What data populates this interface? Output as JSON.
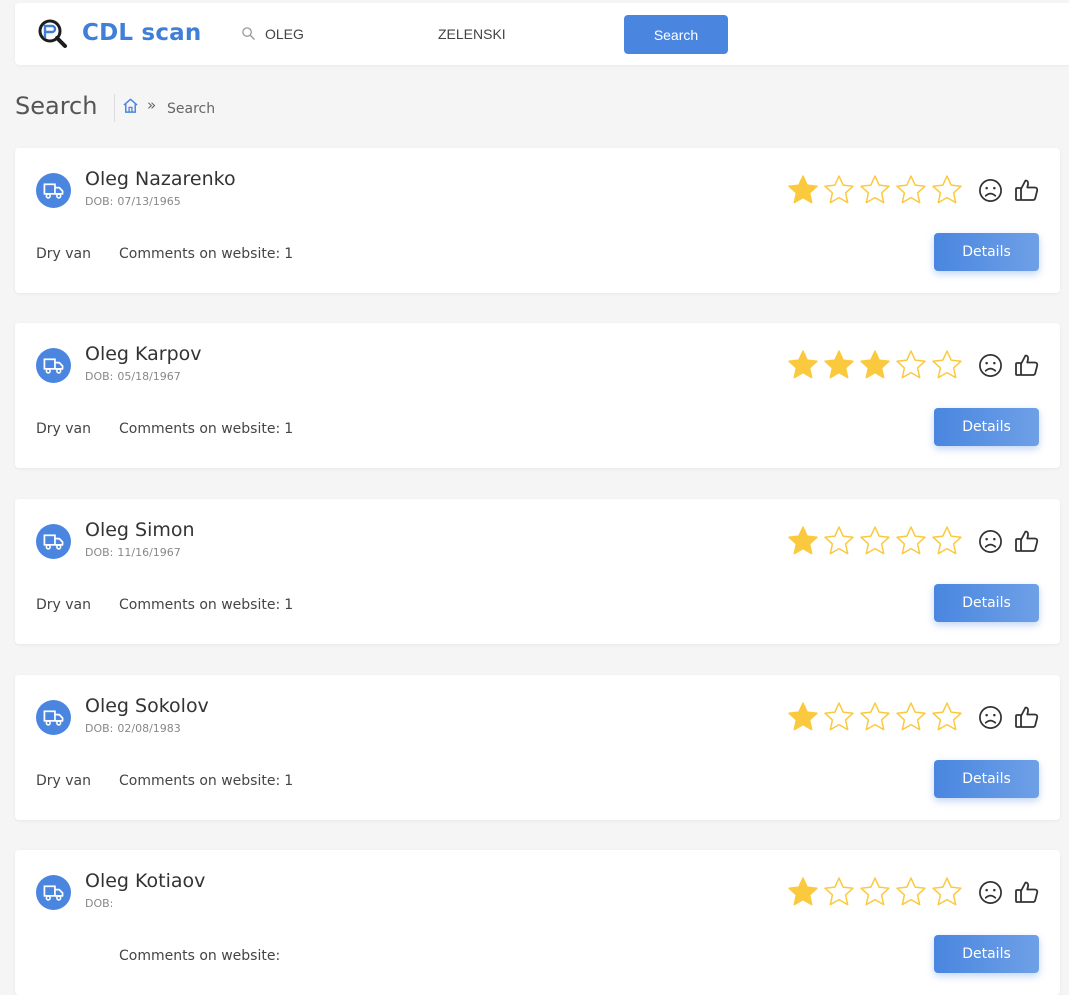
{
  "header": {
    "logo_text": "CDL scan",
    "first_name_value": "OLEG",
    "last_name_value": "ZELENSKI",
    "search_button": "Search"
  },
  "breadcrumb": {
    "page_title": "Search",
    "separator": "»",
    "current": "Search"
  },
  "colors": {
    "accent": "#4a86e0",
    "star_filled": "#fbc93d",
    "star_empty_outline": "#fbc93d"
  },
  "icons": [
    "logo-icon",
    "search-icon",
    "home-icon",
    "truck-icon",
    "star-icon",
    "frown-icon",
    "thumbs-up-icon"
  ],
  "labels": {
    "dob_prefix": "DOB:",
    "comments_prefix": "Comments on website:",
    "details_button": "Details"
  },
  "results": [
    {
      "name": "Oleg Nazarenko",
      "dob": "07/13/1965",
      "truck_type": "Dry van",
      "comments": "1",
      "rating": 1
    },
    {
      "name": "Oleg Karpov",
      "dob": "05/18/1967",
      "truck_type": "Dry van",
      "comments": "1",
      "rating": 3
    },
    {
      "name": "Oleg Simon",
      "dob": "11/16/1967",
      "truck_type": "Dry van",
      "comments": "1",
      "rating": 1
    },
    {
      "name": "Oleg Sokolov",
      "dob": "02/08/1983",
      "truck_type": "Dry van",
      "comments": "1",
      "rating": 1
    },
    {
      "name": "Oleg Kotiaov",
      "dob": "",
      "truck_type": "",
      "comments": "",
      "rating": 1
    }
  ]
}
